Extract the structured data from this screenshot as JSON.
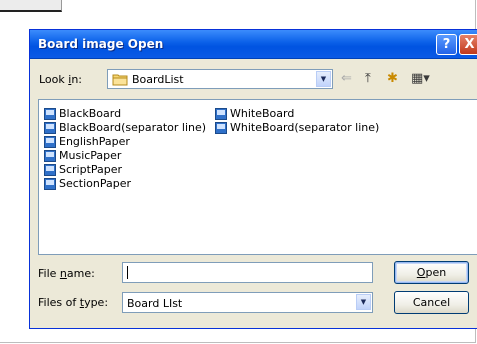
{
  "dialog": {
    "title": "Board image Open",
    "help_button": "?",
    "close_button": "X"
  },
  "look_in": {
    "label_pre": "Look ",
    "label_mnemonic": "i",
    "label_post": "n:",
    "value": "BoardList",
    "dropdown_arrow": "▼"
  },
  "toolbar": {
    "back_icon": "⇐",
    "up_folder_icon": "⤒",
    "new_folder_icon": "✱",
    "views_icon": "▦▾"
  },
  "files": {
    "col1": [
      "BlackBoard",
      "BlackBoard(separator line)",
      "EnglishPaper",
      "MusicPaper",
      "ScriptPaper",
      "SectionPaper"
    ],
    "col2": [
      "WhiteBoard",
      "WhiteBoard(separator line)"
    ]
  },
  "file_name": {
    "label_pre": "File ",
    "label_mnemonic": "n",
    "label_post": "ame:",
    "value": ""
  },
  "file_type": {
    "label_pre": "Files of ",
    "label_mnemonic": "t",
    "label_post": "ype:",
    "value": "Board LIst",
    "dropdown_arrow": "▼"
  },
  "buttons": {
    "open_mnemonic": "O",
    "open_rest": "pen",
    "cancel": "Cancel"
  }
}
